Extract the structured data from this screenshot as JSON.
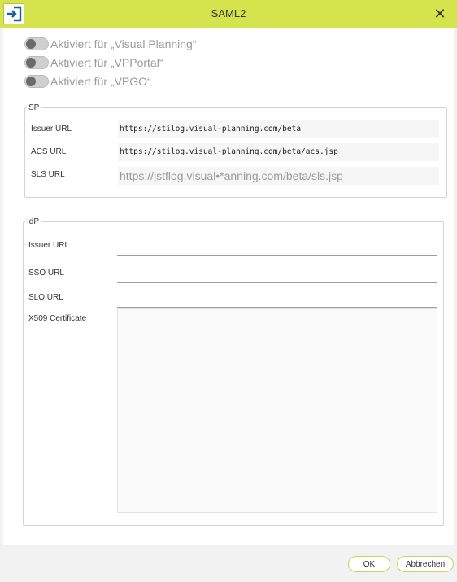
{
  "window": {
    "title": "SAML2",
    "app_icon": "sign-in-icon",
    "close_icon": "close-icon",
    "close_glyph": "✕"
  },
  "toggles": [
    {
      "label": "Aktiviert für „Visual Planning“",
      "enabled": false
    },
    {
      "label": "Aktiviert für „VPPortal“",
      "enabled": false
    },
    {
      "label": "Aktiviert für „VPGO“",
      "enabled": false
    }
  ],
  "sp": {
    "legend": "SP",
    "issuer_url_label": "Issuer URL",
    "issuer_url_value": "https://stilog.visual-planning.com/beta",
    "acs_url_label": "ACS URL",
    "acs_url_value": "https://stilog.visual-planning.com/beta/acs.jsp",
    "sls_url_label": "SLS URL",
    "sls_url_value": "https://jstflog.visual•*anning.com/beta/sls.jsp"
  },
  "idp": {
    "legend": "IdP",
    "issuer_url_label": "Issuer URL",
    "issuer_url_value": "",
    "sso_url_label": "SSO URL",
    "sso_url_value": "",
    "slo_url_label": "SLO URL",
    "slo_url_value": "",
    "certificate_label": "X509 Certificate",
    "certificate_value": ""
  },
  "footer": {
    "ok_label": "OK",
    "cancel_label": "Abbrechen"
  },
  "colors": {
    "titlebar": "#d5e44d",
    "icon_blue": "#1a5f9e",
    "button_border": "#c9d65a"
  }
}
